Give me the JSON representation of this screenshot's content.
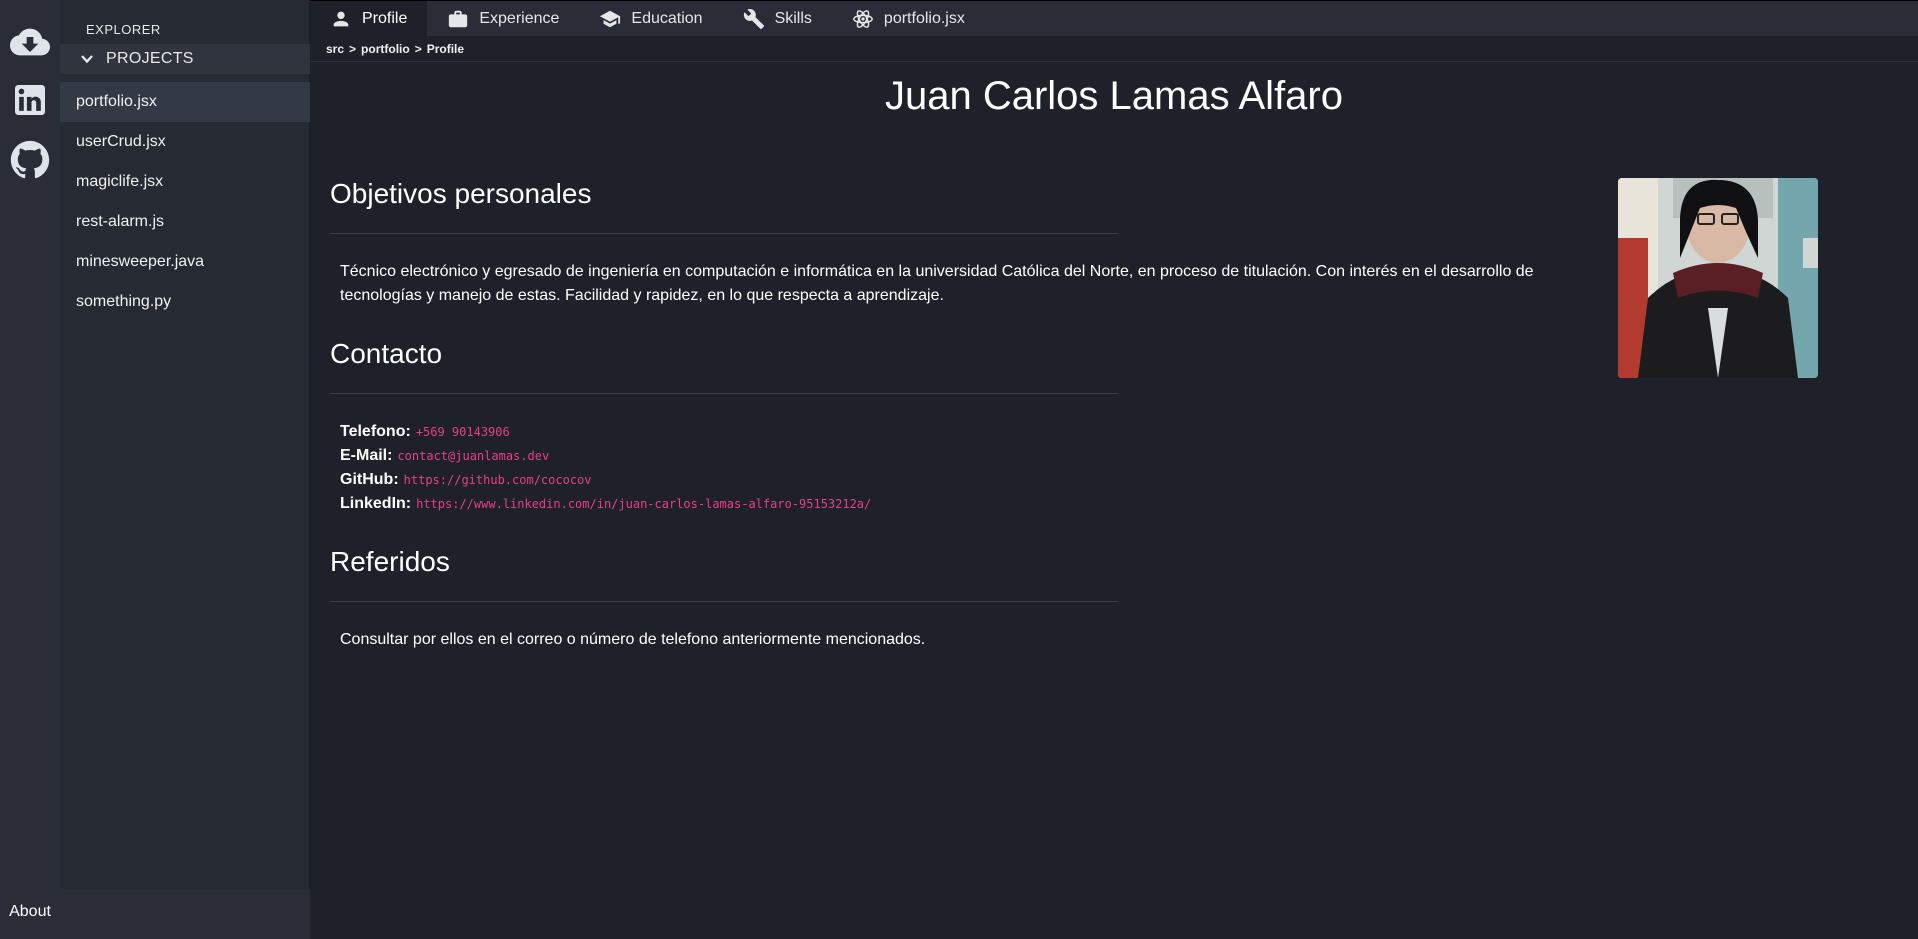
{
  "activity_bar": {
    "icons": [
      "cloud-download-icon",
      "linkedin-icon",
      "github-icon"
    ],
    "about_label": "About"
  },
  "explorer": {
    "title": "EXPLORER",
    "section_label": "PROJECTS",
    "files": [
      {
        "name": "portfolio.jsx",
        "active": true
      },
      {
        "name": "userCrud.jsx",
        "active": false
      },
      {
        "name": "magiclife.jsx",
        "active": false
      },
      {
        "name": "rest-alarm.js",
        "active": false
      },
      {
        "name": "minesweeper.java",
        "active": false
      },
      {
        "name": "something.py",
        "active": false
      }
    ]
  },
  "tabs": [
    {
      "label": "Profile",
      "icon": "person-icon",
      "active": true
    },
    {
      "label": "Experience",
      "icon": "briefcase-icon",
      "active": false
    },
    {
      "label": "Education",
      "icon": "graduation-cap-icon",
      "active": false
    },
    {
      "label": "Skills",
      "icon": "wrench-icon",
      "active": false
    },
    {
      "label": "portfolio.jsx",
      "icon": "react-icon",
      "active": false
    }
  ],
  "breadcrumb": [
    "src",
    "portfolio",
    "Profile"
  ],
  "breadcrumb_separator": ">",
  "profile": {
    "name": "Juan Carlos Lamas Alfaro",
    "sections": {
      "objectives": {
        "title": "Objetivos personales",
        "text": "Técnico electrónico y egresado de ingeniería en computación e informática en la universidad Católica del Norte, en proceso de titulación. Con interés en el desarrollo de tecnologías y manejo de estas. Facilidad y rapidez, en lo que respecta a aprendizaje."
      },
      "contact": {
        "title": "Contacto",
        "items": [
          {
            "label": "Telefono:",
            "value": "+569 90143906"
          },
          {
            "label": "E-Mail:",
            "value": "contact@juanlamas.dev"
          },
          {
            "label": "GitHub:",
            "value": "https://github.com/cococov"
          },
          {
            "label": "LinkedIn:",
            "value": "https://www.linkedin.com/in/juan-carlos-lamas-alfaro-95153212a/"
          }
        ]
      },
      "referrals": {
        "title": "Referidos",
        "text": "Consultar por ellos en el correo o número de telefono anteriormente mencionados."
      }
    }
  },
  "colors": {
    "background": "#1e2129",
    "sidebar": "#262a33",
    "activity_bar": "#2a2d37",
    "link": "#e83e8c"
  }
}
